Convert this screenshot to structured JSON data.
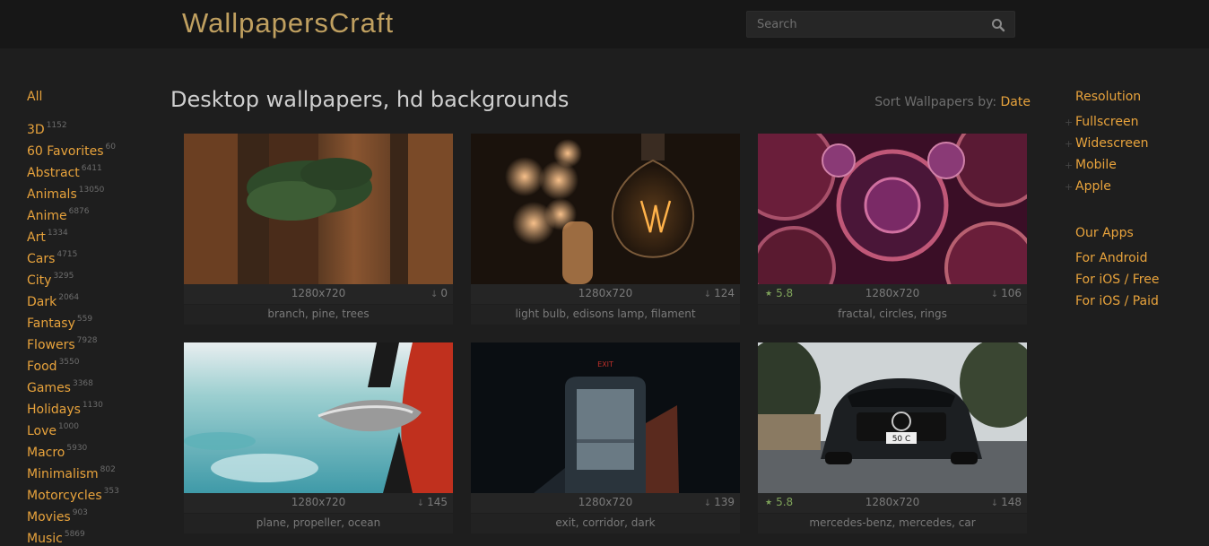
{
  "header": {
    "logo": "WallpapersCraft",
    "search_placeholder": "Search"
  },
  "page": {
    "title": "Desktop wallpapers, hd backgrounds",
    "sort_label": "Sort Wallpapers by:",
    "sort_value": "Date"
  },
  "categories": {
    "all": "All",
    "items": [
      {
        "label": "3D",
        "count": "1152"
      },
      {
        "label": "60 Favorites",
        "count": "60"
      },
      {
        "label": "Abstract",
        "count": "6411"
      },
      {
        "label": "Animals",
        "count": "13050"
      },
      {
        "label": "Anime",
        "count": "6876"
      },
      {
        "label": "Art",
        "count": "1334"
      },
      {
        "label": "Cars",
        "count": "4715"
      },
      {
        "label": "City",
        "count": "3295"
      },
      {
        "label": "Dark",
        "count": "2064"
      },
      {
        "label": "Fantasy",
        "count": "559"
      },
      {
        "label": "Flowers",
        "count": "7928"
      },
      {
        "label": "Food",
        "count": "3550"
      },
      {
        "label": "Games",
        "count": "3368"
      },
      {
        "label": "Holidays",
        "count": "1130"
      },
      {
        "label": "Love",
        "count": "1000"
      },
      {
        "label": "Macro",
        "count": "5930"
      },
      {
        "label": "Minimalism",
        "count": "802"
      },
      {
        "label": "Motorcycles",
        "count": "353"
      },
      {
        "label": "Movies",
        "count": "903"
      },
      {
        "label": "Music",
        "count": "5869"
      }
    ]
  },
  "wallpapers": [
    {
      "resolution": "1280x720",
      "rating": "",
      "downloads": "0",
      "tags": "branch, pine, trees",
      "icon": "pine-branch-photo"
    },
    {
      "resolution": "1280x720",
      "rating": "",
      "downloads": "124",
      "tags": "light bulb, edisons lamp, filament",
      "icon": "light-bulb-photo"
    },
    {
      "resolution": "1280x720",
      "rating": "5.8",
      "downloads": "106",
      "tags": "fractal, circles, rings",
      "icon": "fractal-photo"
    },
    {
      "resolution": "1280x720",
      "rating": "",
      "downloads": "145",
      "tags": "plane, propeller, ocean",
      "icon": "plane-propeller-photo"
    },
    {
      "resolution": "1280x720",
      "rating": "",
      "downloads": "139",
      "tags": "exit, corridor, dark",
      "icon": "exit-corridor-photo"
    },
    {
      "resolution": "1280x720",
      "rating": "5.8",
      "downloads": "148",
      "tags": "mercedes-benz, mercedes, car",
      "icon": "mercedes-car-photo"
    }
  ],
  "exit_sign": "EXIT",
  "plate": "50 C",
  "resolution": {
    "heading": "Resolution",
    "items": [
      "Fullscreen",
      "Widescreen",
      "Mobile",
      "Apple"
    ]
  },
  "apps": {
    "heading": "Our Apps",
    "items": [
      "For Android",
      "For iOS / Free",
      "For iOS / Paid"
    ]
  },
  "colors": {
    "accent": "#e8a33c",
    "logo": "#c0a060",
    "background": "#1e1e1e",
    "header": "#171717",
    "rating": "#7fa35a"
  }
}
